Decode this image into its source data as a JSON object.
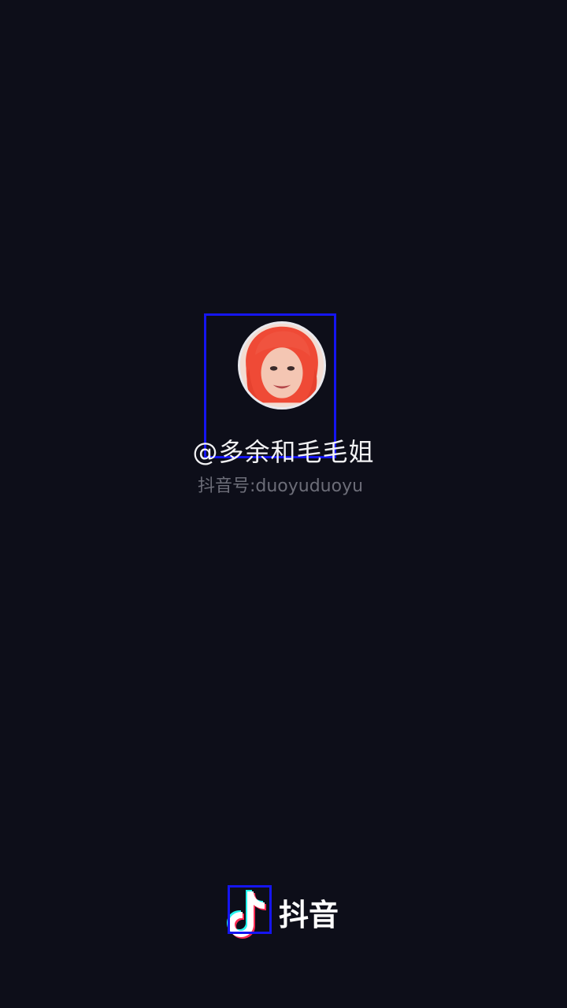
{
  "profile": {
    "avatar_icon": "user-avatar-photo",
    "username": "@多余和毛毛姐",
    "account_id": "抖音号:duoyuduoyu"
  },
  "brand": {
    "logo_icon": "douyin-note-icon",
    "name": "抖音"
  },
  "colors": {
    "background": "#0d0e19",
    "highlight_box": "#1515f0",
    "text_primary": "#f2f2f4",
    "text_secondary": "#6c6d78",
    "logo_cyan": "#25f4ee",
    "logo_pink": "#fe2c55"
  }
}
